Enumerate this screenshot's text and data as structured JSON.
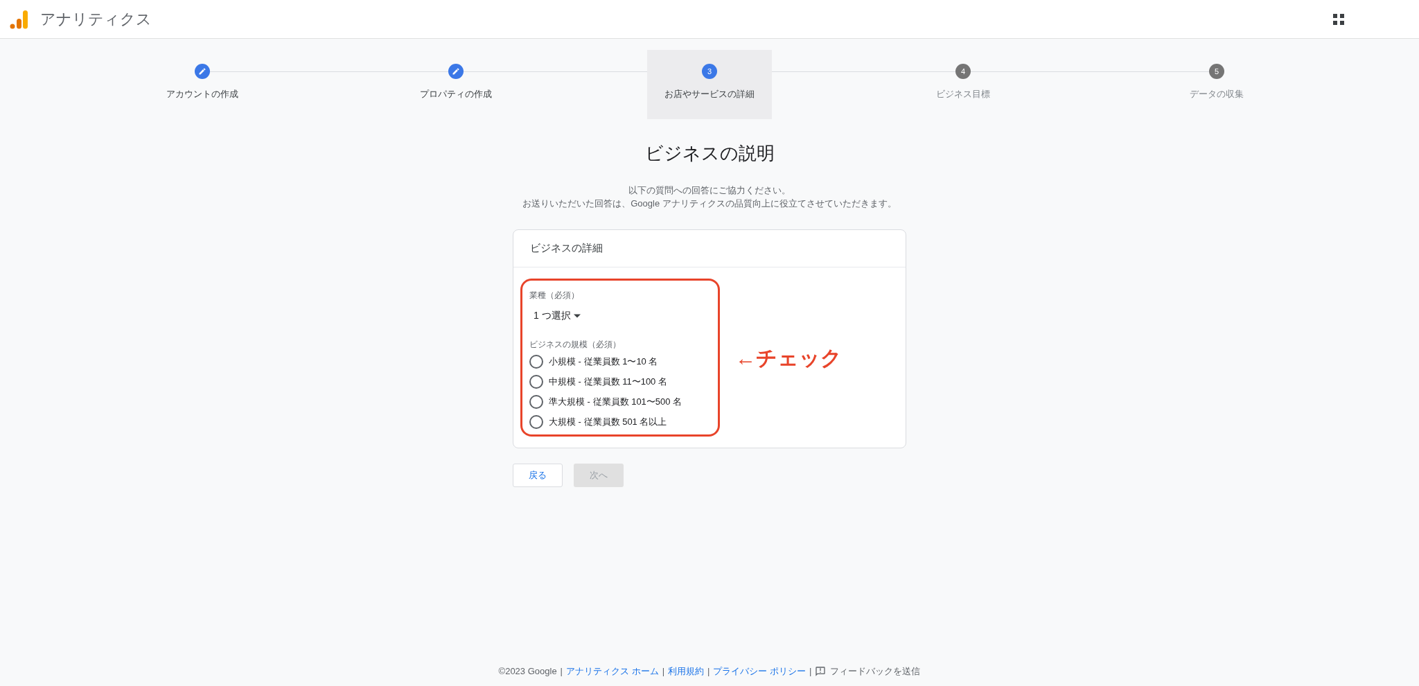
{
  "header": {
    "title": "アナリティクス"
  },
  "steps": [
    {
      "label": "アカウントの作成",
      "completed": true,
      "selected": false
    },
    {
      "label": "プロパティの作成",
      "completed": true,
      "selected": false
    },
    {
      "number": "3",
      "label": "お店やサービスの詳細",
      "completed": false,
      "selected": true
    },
    {
      "number": "4",
      "label": "ビジネス目標",
      "completed": false,
      "selected": false
    },
    {
      "number": "5",
      "label": "データの収集",
      "completed": false,
      "selected": false
    }
  ],
  "page": {
    "title": "ビジネスの説明",
    "description": [
      "以下の質問への回答にご協力ください。",
      "お送りいただいた回答は、Google アナリティクスの品質向上に役立てさせていただきます。"
    ]
  },
  "card": {
    "title": "ビジネスの詳細",
    "industry": {
      "label": "業種（必須）",
      "value": "1 つ選択"
    },
    "size": {
      "label": "ビジネスの規模（必須）",
      "options": [
        {
          "label": "小規模 - 従業員数 1〜10 名",
          "selected": false
        },
        {
          "label": "中規模 - 従業員数 11〜100 名",
          "selected": false
        },
        {
          "label": "準大規模 - 従業員数 101〜500 名",
          "selected": false
        },
        {
          "label": "大規模 - 従業員数 501 名以上",
          "selected": false
        }
      ]
    }
  },
  "annotation": {
    "text": "←チェック"
  },
  "buttons": [
    {
      "label": "戻る",
      "disabled": false
    },
    {
      "label": "次へ",
      "disabled": true
    }
  ],
  "footer": [
    {
      "text": "©2023 Google",
      "kind": "text"
    },
    {
      "text": "|",
      "kind": "separator"
    },
    {
      "text": "アナリティクス ホーム",
      "kind": "link"
    },
    {
      "text": "|",
      "kind": "separator"
    },
    {
      "text": "利用規約",
      "kind": "link"
    },
    {
      "text": "|",
      "kind": "separator"
    },
    {
      "text": "プライバシー ポリシー",
      "kind": "link"
    },
    {
      "text": "|",
      "kind": "separator"
    },
    {
      "text": "フィードバックを送信",
      "kind": "feedback"
    }
  ]
}
